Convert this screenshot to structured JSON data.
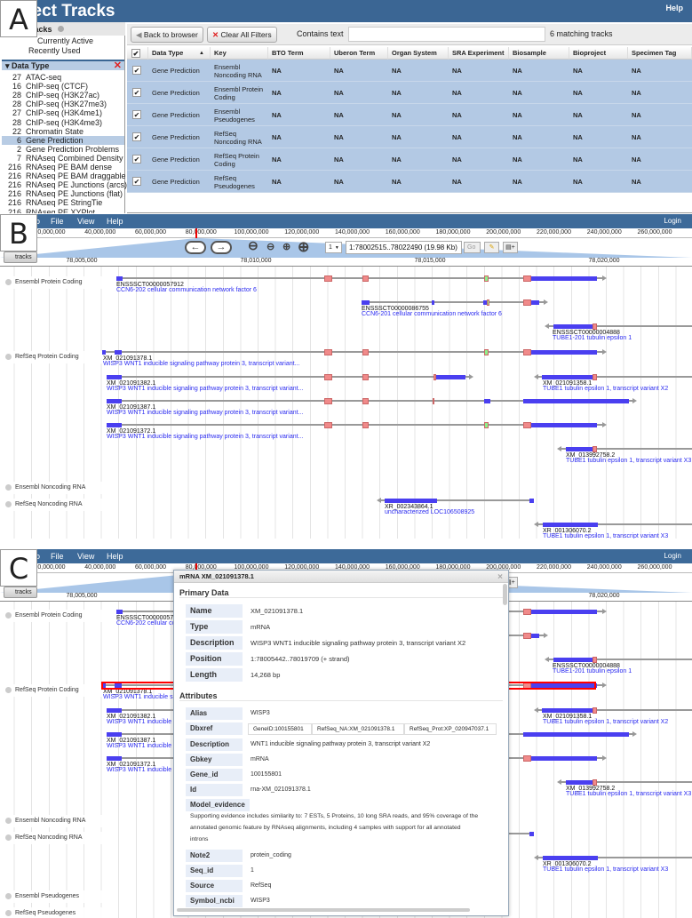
{
  "panel_labels": [
    "A",
    "B",
    "C"
  ],
  "track_selector": {
    "title": "Select Tracks",
    "help": "Help",
    "sidebar": {
      "header": "Tracks",
      "quick": [
        "Currently Active",
        "Recently Used"
      ],
      "facet_title": "Data Type",
      "items": [
        {
          "count": "27",
          "label": "ATAC-seq"
        },
        {
          "count": "16",
          "label": "ChIP-seq (CTCF)"
        },
        {
          "count": "28",
          "label": "ChIP-seq (H3K27ac)"
        },
        {
          "count": "28",
          "label": "ChIP-seq (H3K27me3)"
        },
        {
          "count": "27",
          "label": "ChIP-seq (H3K4me1)"
        },
        {
          "count": "28",
          "label": "ChIP-seq (H3K4me3)"
        },
        {
          "count": "22",
          "label": "Chromatin State"
        },
        {
          "count": "6",
          "label": "Gene Prediction",
          "selected": true
        },
        {
          "count": "2",
          "label": "Gene Prediction Problems"
        },
        {
          "count": "7",
          "label": "RNAseq Combined Density"
        },
        {
          "count": "216",
          "label": "RNAseq PE BAM dense"
        },
        {
          "count": "216",
          "label": "RNAseq PE BAM draggable"
        },
        {
          "count": "216",
          "label": "RNAseq PE Junctions (arcs)"
        },
        {
          "count": "216",
          "label": "RNAseq PE Junctions (flat)"
        },
        {
          "count": "216",
          "label": "RNAseq PE StringTie"
        },
        {
          "count": "216",
          "label": "RNAseq PE XYPlot"
        }
      ]
    },
    "toolbar": {
      "back": "Back to browser",
      "clear": "Clear All Filters",
      "contains": "Contains text",
      "search_value": "",
      "matching": "6 matching tracks"
    },
    "columns": [
      "Data Type",
      "Key",
      "BTO Term",
      "Uberon Term",
      "Organ System",
      "SRA Experiment",
      "Biosample",
      "Bioproject",
      "Specimen Tag"
    ],
    "sort_column": "Data Type",
    "rows": [
      [
        "Gene Prediction",
        "Ensembl Noncoding RNA",
        "NA",
        "NA",
        "NA",
        "NA",
        "NA",
        "NA",
        "NA"
      ],
      [
        "Gene Prediction",
        "Ensembl Protein Coding",
        "NA",
        "NA",
        "NA",
        "NA",
        "NA",
        "NA",
        "NA"
      ],
      [
        "Gene Prediction",
        "Ensembl Pseudogenes",
        "NA",
        "NA",
        "NA",
        "NA",
        "NA",
        "NA",
        "NA"
      ],
      [
        "Gene Prediction",
        "RefSeq Noncoding RNA",
        "NA",
        "NA",
        "NA",
        "NA",
        "NA",
        "NA",
        "NA"
      ],
      [
        "Gene Prediction",
        "RefSeq Protein Coding",
        "NA",
        "NA",
        "NA",
        "NA",
        "NA",
        "NA",
        "NA"
      ],
      [
        "Gene Prediction",
        "RefSeq Pseudogenes",
        "NA",
        "NA",
        "NA",
        "NA",
        "NA",
        "NA",
        "NA"
      ]
    ],
    "checked": true
  },
  "browser": {
    "menu_prefix": "o",
    "menu": [
      "File",
      "View",
      "Help"
    ],
    "login": "Login",
    "overview_ticks": [
      "20,000,000",
      "40,000,000",
      "60,000,000",
      "80,000,000",
      "100,000,000",
      "120,000,000",
      "140,000,000",
      "160,000,000",
      "180,000,000",
      "200,000,000",
      "220,000,000",
      "240,000,000",
      "260,000,000"
    ],
    "ref_seq": "1",
    "location": "1:78002515..78022490 (19.98 Kb)",
    "go": "Go",
    "tracks_button": "tracks",
    "detail_ticks": [
      "78,005,000",
      "78,010,000",
      "78,015,000",
      "78,020,000"
    ],
    "track_labels": [
      "Ensembl Protein Coding",
      "RefSeq Protein Coding",
      "Ensembl Noncoding RNA",
      "RefSeq Noncoding RNA",
      "Ensembl Pseudogenes",
      "RefSeq Pseudogenes"
    ],
    "features": [
      {
        "name": "ENSSSCT00000057912",
        "description": "CCN6-202 cellular communication network factor 6"
      },
      {
        "name": "ENSSSCT00000086755",
        "description": "CCN6-201 cellular communication network factor 6"
      },
      {
        "name": "ENSSSCT00000004888",
        "description": "TUBE1-201 tubulin epsilon 1"
      },
      {
        "name": "XM_021091378.1",
        "description": "WISP3 WNT1 inducible signaling pathway protein 3, transcript variant..."
      },
      {
        "name": "XM_021091382.1",
        "description": "WISP3 WNT1 inducible signaling pathway protein 3, transcript variant..."
      },
      {
        "name": "XM_021091358.1",
        "description": "TUBE1 tubulin epsilon 1, transcript variant X2"
      },
      {
        "name": "XM_021091387.1",
        "description": "WISP3 WNT1 inducible signaling pathway protein 3, transcript variant..."
      },
      {
        "name": "XM_021091372.1",
        "description": "WISP3 WNT1 inducible signaling pathway protein 3, transcript variant..."
      },
      {
        "name": "XM_013992758.2",
        "description": "TUBE1 tubulin epsilon 1, transcript variant X3"
      },
      {
        "name": "XR_002343864.1",
        "description": "uncharacterized LOC106508925"
      },
      {
        "name": "XR_001306070.2",
        "description": "TUBE1 tubulin epsilon 1, transcript variant X3"
      }
    ],
    "colors": {
      "cds": "#4a3ff0",
      "exon": "#f08a8a",
      "start_codon": "#8ef08a",
      "intron": "#999999",
      "selected": "#ff0000",
      "menubar": "#3d6a99"
    }
  },
  "popup": {
    "title": "mRNA XM_021091378.1",
    "close": "×",
    "primary_title": "Primary Data",
    "primary": [
      {
        "key": "Name",
        "value": "XM_021091378.1"
      },
      {
        "key": "Type",
        "value": "mRNA"
      },
      {
        "key": "Description",
        "value": "WISP3 WNT1 inducible signaling pathway protein 3, transcript variant X2"
      },
      {
        "key": "Position",
        "value": "1:78005442..78019709 (+ strand)"
      },
      {
        "key": "Length",
        "value": "14,268 bp"
      }
    ],
    "attributes_title": "Attributes",
    "alias": {
      "key": "Alias",
      "value": "WISP3"
    },
    "dbxref": {
      "key": "Dbxref",
      "values": [
        "GeneID:100155801",
        "RefSeq_NA:XM_021091378.1",
        "RefSeq_Prot:XP_020947037.1"
      ]
    },
    "attributes": [
      {
        "key": "Description",
        "value": "WNT1 inducible signaling pathway protein 3, transcript variant X2"
      },
      {
        "key": "Gbkey",
        "value": "mRNA"
      },
      {
        "key": "Gene_id",
        "value": "100155801"
      },
      {
        "key": "Id",
        "value": "rna-XM_021091378.1"
      }
    ],
    "model_evidence": {
      "key": "Model_evidence",
      "lines": [
        "Supporting evidence includes similarity to: 7 ESTs, 5 Proteins, 10 long SRA reads, and 95% coverage of the",
        "annotated genomic feature by RNAseq alignments, including 4 samples with support for all annotated",
        "introns"
      ]
    },
    "attributes2": [
      {
        "key": "Note2",
        "value": "protein_coding"
      },
      {
        "key": "Seq_id",
        "value": "1"
      },
      {
        "key": "Source",
        "value": "RefSeq"
      },
      {
        "key": "Symbol_ncbi",
        "value": "WISP3"
      }
    ]
  }
}
